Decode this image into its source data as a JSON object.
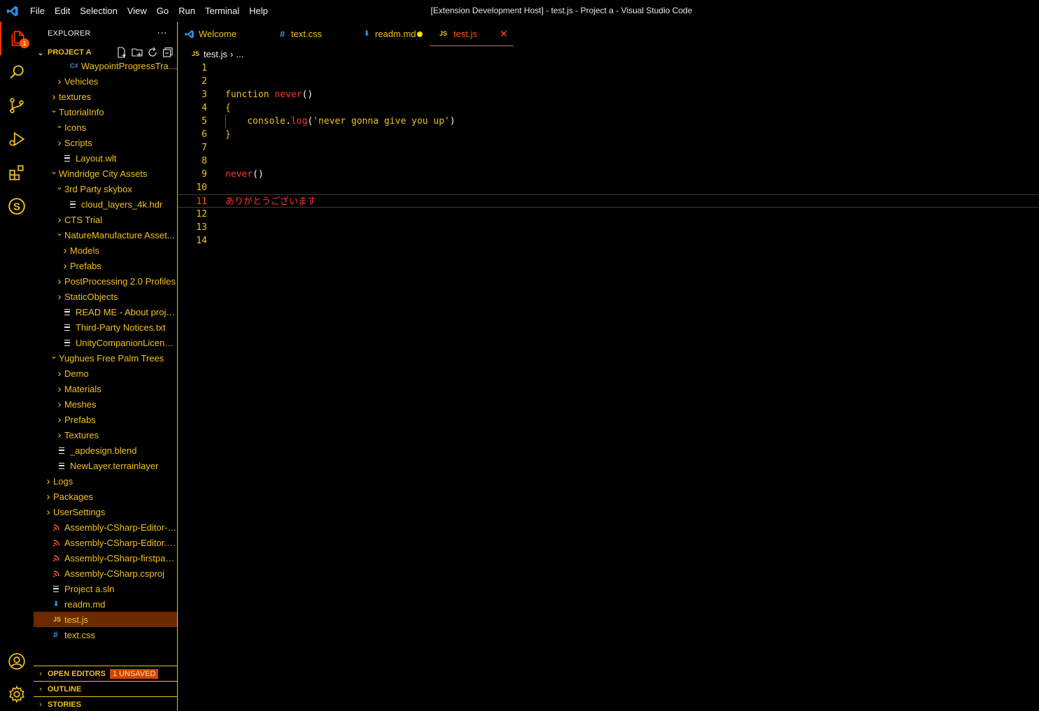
{
  "window": {
    "title": "[Extension Development Host] - test.js - Project a - Visual Studio Code",
    "menu": [
      "File",
      "Edit",
      "Selection",
      "View",
      "Go",
      "Run",
      "Terminal",
      "Help"
    ]
  },
  "activity_bar": {
    "explorer_badge": "1",
    "items": [
      "files-icon",
      "search-icon",
      "source-control-icon",
      "run-debug-icon",
      "extensions-icon",
      "s-extension-icon",
      "account-icon",
      "manage-gear-icon"
    ]
  },
  "sidebar": {
    "title": "EXPLORER",
    "more": "···",
    "project": "PROJECT A",
    "tree": [
      {
        "label": "WaypointProgressTracker...",
        "depth": 5,
        "kind": "cs",
        "twisty": ""
      },
      {
        "label": "Vehicles",
        "depth": 4,
        "kind": "folder",
        "twisty": "›"
      },
      {
        "label": "textures",
        "depth": 3,
        "kind": "folder",
        "twisty": "›"
      },
      {
        "label": "TutorialInfo",
        "depth": 3,
        "kind": "folder",
        "twisty": "⌄"
      },
      {
        "label": "Icons",
        "depth": 4,
        "kind": "folder",
        "twisty": "⌄"
      },
      {
        "label": "Scripts",
        "depth": 4,
        "kind": "folder",
        "twisty": "›"
      },
      {
        "label": "Layout.wlt",
        "depth": 4,
        "kind": "lines",
        "twisty": ""
      },
      {
        "label": "Windridge City Assets",
        "depth": 3,
        "kind": "folder",
        "twisty": "⌄"
      },
      {
        "label": "3rd Party skybox",
        "depth": 4,
        "kind": "folder",
        "twisty": "⌄"
      },
      {
        "label": "cloud_layers_4k.hdr",
        "depth": 5,
        "kind": "lines",
        "twisty": ""
      },
      {
        "label": "CTS Trial",
        "depth": 4,
        "kind": "folder",
        "twisty": "›"
      },
      {
        "label": "NatureManufacture Asset...",
        "depth": 4,
        "kind": "folder",
        "twisty": "⌄"
      },
      {
        "label": "Models",
        "depth": 5,
        "kind": "folder",
        "twisty": "›"
      },
      {
        "label": "Prefabs",
        "depth": 5,
        "kind": "folder",
        "twisty": "›"
      },
      {
        "label": "PostProcessing 2.0 Profiles",
        "depth": 4,
        "kind": "folder",
        "twisty": "›"
      },
      {
        "label": "StaticObjects",
        "depth": 4,
        "kind": "folder",
        "twisty": "›"
      },
      {
        "label": "READ ME - About project...",
        "depth": 4,
        "kind": "lines",
        "twisty": ""
      },
      {
        "label": "Third-Party Notices.txt",
        "depth": 4,
        "kind": "lines",
        "twisty": ""
      },
      {
        "label": "UnityCompanionLicense_...",
        "depth": 4,
        "kind": "lines",
        "twisty": ""
      },
      {
        "label": "Yughues Free Palm Trees",
        "depth": 3,
        "kind": "folder",
        "twisty": "⌄"
      },
      {
        "label": "Demo",
        "depth": 4,
        "kind": "folder",
        "twisty": "›"
      },
      {
        "label": "Materials",
        "depth": 4,
        "kind": "folder",
        "twisty": "›"
      },
      {
        "label": "Meshes",
        "depth": 4,
        "kind": "folder",
        "twisty": "›"
      },
      {
        "label": "Prefabs",
        "depth": 4,
        "kind": "folder",
        "twisty": "›"
      },
      {
        "label": "Textures",
        "depth": 4,
        "kind": "folder",
        "twisty": "›"
      },
      {
        "label": "_apdesign.blend",
        "depth": 3,
        "kind": "lines",
        "twisty": ""
      },
      {
        "label": "NewLayer.terrainlayer",
        "depth": 3,
        "kind": "lines",
        "twisty": ""
      },
      {
        "label": "Logs",
        "depth": 2,
        "kind": "folder",
        "twisty": "›"
      },
      {
        "label": "Packages",
        "depth": 2,
        "kind": "folder",
        "twisty": "›"
      },
      {
        "label": "UserSettings",
        "depth": 2,
        "kind": "folder",
        "twisty": "›"
      },
      {
        "label": "Assembly-CSharp-Editor-firs...",
        "depth": 2,
        "kind": "rss",
        "twisty": ""
      },
      {
        "label": "Assembly-CSharp-Editor.csp...",
        "depth": 2,
        "kind": "rss",
        "twisty": ""
      },
      {
        "label": "Assembly-CSharp-firstpass.c...",
        "depth": 2,
        "kind": "rss",
        "twisty": ""
      },
      {
        "label": "Assembly-CSharp.csproj",
        "depth": 2,
        "kind": "rss",
        "twisty": ""
      },
      {
        "label": "Project a.sln",
        "depth": 2,
        "kind": "lines",
        "twisty": ""
      },
      {
        "label": "readm.md",
        "depth": 2,
        "kind": "md",
        "twisty": ""
      },
      {
        "label": "test.js",
        "depth": 2,
        "kind": "js",
        "twisty": "",
        "selected": true
      },
      {
        "label": "text.css",
        "depth": 2,
        "kind": "css",
        "twisty": ""
      }
    ],
    "sections": {
      "open_editors": "OPEN EDITORS",
      "unsaved": "1 UNSAVED",
      "outline": "OUTLINE",
      "stories": "STORIES"
    }
  },
  "tabs": [
    {
      "label": "Welcome",
      "icon": "vscode",
      "width": 122
    },
    {
      "label": "text.css",
      "icon": "#",
      "width": 120
    },
    {
      "label": "readm.md",
      "icon": "md",
      "width": 118,
      "dirty": true
    },
    {
      "label": "test.js",
      "icon": "JS",
      "width": 120,
      "active": true
    }
  ],
  "breadcrumb": {
    "icon": "JS",
    "file": "test.js",
    "rest": "..."
  },
  "editor": {
    "current_line": 11,
    "lines": [
      {
        "n": "1",
        "tokens": []
      },
      {
        "n": "2",
        "tokens": []
      },
      {
        "n": "3",
        "tokens": [
          {
            "t": "function ",
            "c": "kw"
          },
          {
            "t": "never",
            "c": "fn"
          },
          {
            "t": "()",
            "c": "punc"
          }
        ]
      },
      {
        "n": "4",
        "tokens": [
          {
            "t": "{",
            "c": "plain"
          }
        ]
      },
      {
        "n": "5",
        "tokens": [
          {
            "t": "    console",
            "c": "plain"
          },
          {
            "t": ".",
            "c": "punc"
          },
          {
            "t": "log",
            "c": "fn"
          },
          {
            "t": "(",
            "c": "punc"
          },
          {
            "t": "'never gonna give you up'",
            "c": "str"
          },
          {
            "t": ")",
            "c": "punc"
          }
        ]
      },
      {
        "n": "6",
        "tokens": [
          {
            "t": "}",
            "c": "plain"
          }
        ]
      },
      {
        "n": "7",
        "tokens": []
      },
      {
        "n": "8",
        "tokens": []
      },
      {
        "n": "9",
        "tokens": [
          {
            "t": "never",
            "c": "fn"
          },
          {
            "t": "()",
            "c": "punc"
          }
        ]
      },
      {
        "n": "10",
        "tokens": []
      },
      {
        "n": "11",
        "tokens": [
          {
            "t": "ありがとうございます",
            "c": "err"
          }
        ]
      },
      {
        "n": "12",
        "tokens": []
      },
      {
        "n": "13",
        "tokens": []
      },
      {
        "n": "14",
        "tokens": []
      }
    ]
  },
  "colors": {
    "accent": "#f0c020",
    "highlight": "#ff5500",
    "error": "#ff3333",
    "selection": "#6b2a00"
  }
}
